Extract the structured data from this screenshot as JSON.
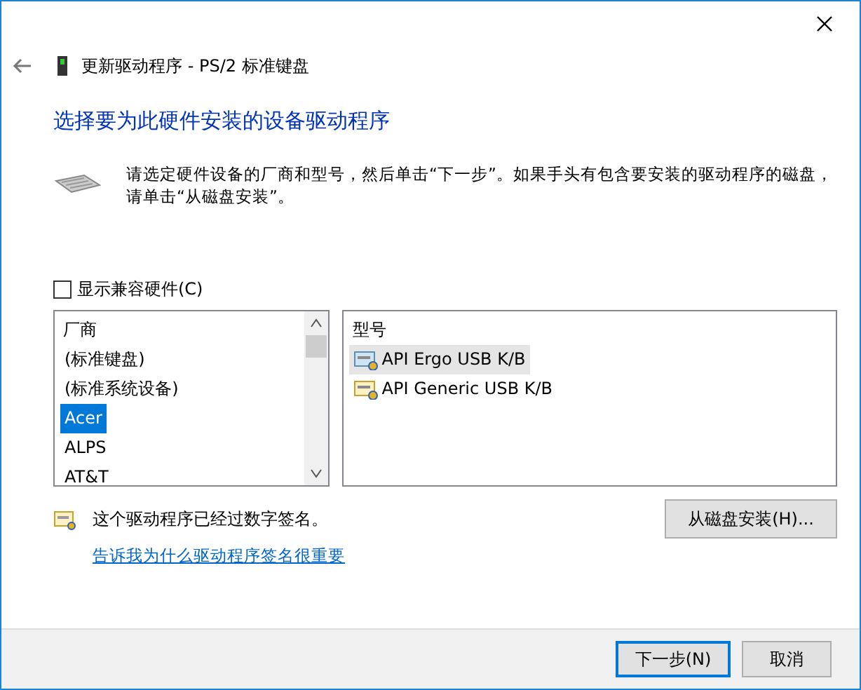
{
  "window": {
    "title": "更新驱动程序 - PS/2 标准键盘"
  },
  "heading": "选择要为此硬件安装的设备驱动程序",
  "instructions": [
    "请选定硬件设备的厂商和型号，然后单击“下一步”。如果手头有包含要安装的驱动程序的磁盘，",
    "请单击“从磁盘安装”。"
  ],
  "show_compatible": {
    "label": "显示兼容硬件(C)",
    "checked": false
  },
  "manufacturers": {
    "header": "厂商",
    "items": [
      {
        "label": "(标准键盘)",
        "selected": false
      },
      {
        "label": "(标准系统设备)",
        "selected": false
      },
      {
        "label": "Acer",
        "selected": true
      },
      {
        "label": "ALPS",
        "selected": false
      },
      {
        "label": "AT&T",
        "selected": false
      }
    ]
  },
  "models": {
    "header": "型号",
    "items": [
      {
        "label": "API Ergo USB K/B",
        "selected": true
      },
      {
        "label": "API Generic USB K/B",
        "selected": false
      }
    ]
  },
  "signature": {
    "text": "这个驱动程序已经过数字签名。",
    "link": "告诉我为什么驱动程序签名很重要"
  },
  "have_disk": "从磁盘安装(H)...",
  "buttons": [
    {
      "label": "下一步(N)",
      "kind": "default"
    },
    {
      "label": "取消",
      "kind": "normal"
    }
  ]
}
